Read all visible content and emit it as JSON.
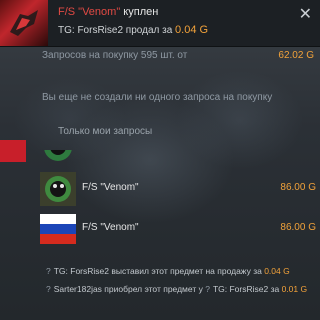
{
  "notification": {
    "item": "F/S \"Venom\"",
    "status": "куплен",
    "seller": "TG: ForsRise2 продал за ",
    "price": "0.04 G"
  },
  "summary": {
    "label": "Запросов на покупку 595 шт. от",
    "value": "62.02 G"
  },
  "empty_requests": "Вы еще не создали ни одного запроса на покупку",
  "tab_mine": "Только мои запросы",
  "listings": [
    {
      "name": "F/S \"Venom\"",
      "price": "86.00 G"
    },
    {
      "name": "F/S \"Venom\"",
      "price": "86.00 G"
    }
  ],
  "log": [
    {
      "user": "TG: ForsRise2",
      "text": " выставил этот предмет на продажу за ",
      "price": "0.04 G"
    },
    {
      "user": "Sarter182jas",
      "text": " приобрел этот предмет у ",
      "user2": "TG: ForsRise2",
      "text2": " за ",
      "price": "0.01 G"
    }
  ]
}
